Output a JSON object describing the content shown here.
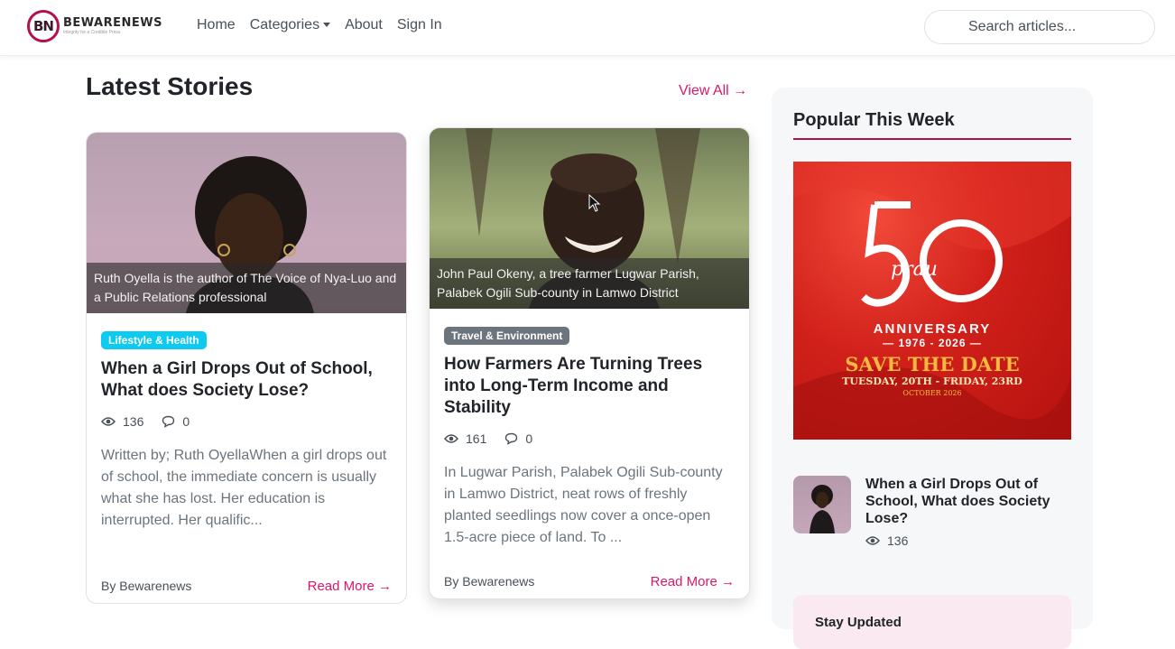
{
  "brand": {
    "name": "BEWARENEWS",
    "logo_letters": "BN",
    "tagline": "Integrity for a Credible Press",
    "accent_color": "#d6186b"
  },
  "nav": {
    "items": [
      {
        "label": "Home"
      },
      {
        "label": "Categories"
      },
      {
        "label": "About"
      },
      {
        "label": "Sign In"
      }
    ]
  },
  "search": {
    "placeholder": "Search articles..."
  },
  "latest": {
    "title": "Latest Stories",
    "view_all": "View All →"
  },
  "cards": [
    {
      "caption": "Ruth Oyella is the author of The Voice of Nya-Luo and a Public Relations professional",
      "category": "Lifestyle & Health",
      "title": "When a Girl Drops Out of School, What does Society Lose?",
      "views": "136",
      "comments": "0",
      "excerpt": "Written by; Ruth OyellaWhen a girl drops out of school, the immediate concern is usually what she has lost. Her education is interrupted. Her qualific...",
      "author": "By Bewarenews",
      "read_more": "Read More →"
    },
    {
      "caption": "John Paul Okeny, a tree farmer Lugwar Parish, Palabek Ogili Sub-county in Lamwo District",
      "category": "Travel & Environment",
      "title": "How Farmers Are Turning Trees into Long-Term Income and Stability",
      "views": "161",
      "comments": "0",
      "excerpt": "In Lugwar Parish, Palabek Ogili Sub-county in Lamwo District, neat rows of freshly planted seedlings now cover a once-open 1.5-acre piece of land. To ...",
      "author": "By Bewarenews",
      "read_more": "Read More →"
    }
  ],
  "sidebar": {
    "title": "Popular This Week",
    "ad": {
      "number": "50",
      "org": "prau",
      "anniversary": "ANNIVERSARY",
      "years": "— 1976 - 2026 —",
      "save": "SAVE THE DATE",
      "dates": "TUESDAY, 20TH - FRIDAY, 23RD",
      "month": "OCTOBER 2026"
    },
    "popular": [
      {
        "title": "When a Girl Drops Out of School, What does Society Lose?",
        "views": "136"
      }
    ],
    "newsletter_title": "Stay Updated"
  }
}
